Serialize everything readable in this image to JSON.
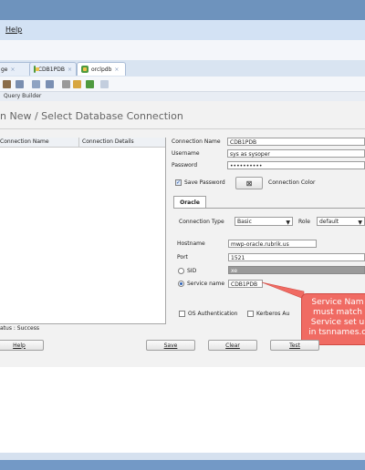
{
  "menu": {
    "help_label": "Help"
  },
  "tabs": [
    {
      "label": "ge"
    },
    {
      "label": "CDB1PDB"
    },
    {
      "label": "orclpdb"
    }
  ],
  "tab_close_glyph": "×",
  "query_builder_label": "Query Builder",
  "dialog": {
    "title": "n New / Select Database Connection",
    "list": {
      "col_name": "Connection Name",
      "col_details": "Connection Details"
    },
    "fields": {
      "connection_name_label": "Connection Name",
      "connection_name_value": "CDB1PDB",
      "username_label": "Username",
      "username_value": "sys as sysoper",
      "password_label": "Password",
      "password_value": "••••••••••",
      "save_password_label": "Save Password",
      "connection_color_label": "Connection Color",
      "oracle_tab_label": "Oracle",
      "connection_type_label": "Connection Type",
      "connection_type_value": "Basic",
      "role_label": "Role",
      "role_value": "default",
      "hostname_label": "Hostname",
      "hostname_value": "mwp-oracle.rubrik.us",
      "port_label": "Port",
      "port_value": "1521",
      "sid_label": "SID",
      "sid_value": "xe",
      "service_name_label": "Service name",
      "service_name_value": "CDB1PDB",
      "os_auth_label": "OS Authentication",
      "kerberos_label": "Kerberos Au"
    },
    "status_text": "atus : Success",
    "buttons": {
      "help": "Help",
      "save": "Save",
      "clear": "Clear",
      "test": "Test"
    }
  },
  "callout": {
    "line1": "Service Nam",
    "line2": "must match",
    "line3": "Service set u",
    "line4": "in tsnnames.o"
  },
  "colors": {
    "accent": "#6e93bd",
    "callout": "#f06b63",
    "dialog_bg": "#f2f2f2"
  }
}
